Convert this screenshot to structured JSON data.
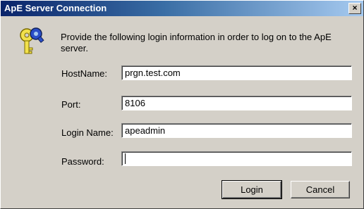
{
  "window": {
    "title": "ApE Server Connection",
    "close_glyph": "×"
  },
  "icon": "keys-icon",
  "message": "Provide the following login information in order to log on to the ApE server.",
  "fields": [
    {
      "label": "HostName:",
      "value": "prgn.test.com"
    },
    {
      "label": "Port:",
      "value": "8106"
    },
    {
      "label": "Login Name:",
      "value": "apeadmin"
    },
    {
      "label": "Password:",
      "value": ""
    }
  ],
  "buttons": {
    "login": "Login",
    "cancel": "Cancel"
  },
  "colors": {
    "titlebar_start": "#0a246a",
    "titlebar_end": "#a6caf0",
    "face": "#d4d0c8"
  }
}
